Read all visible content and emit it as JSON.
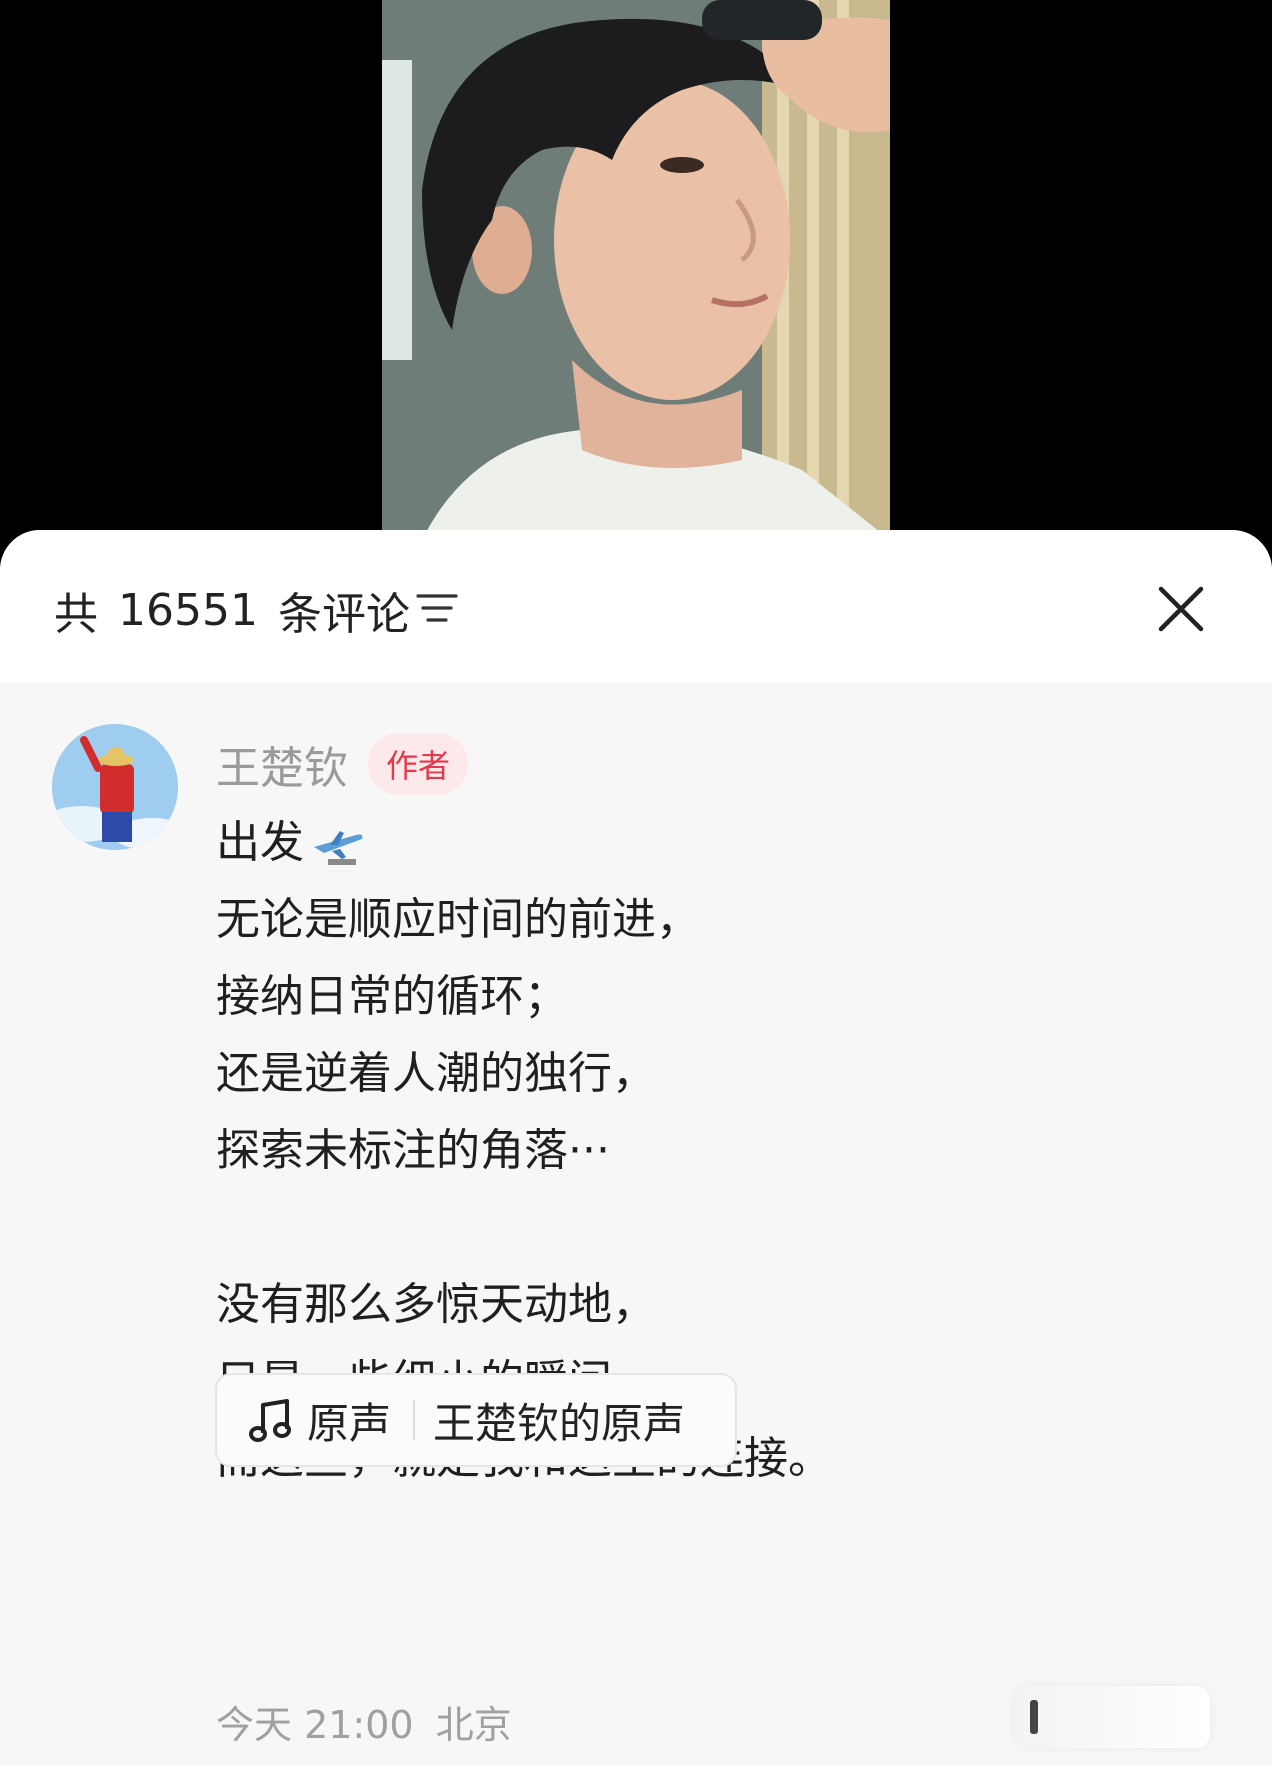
{
  "header": {
    "count_prefix": "共",
    "count": "16551",
    "count_suffix": "条评论",
    "sort_icon": "filter-lines-icon",
    "close_icon": "close-icon"
  },
  "comment": {
    "author": "王楚钦",
    "badge": "作者",
    "lines": [
      "出发",
      "无论是顺应时间的前进，",
      "接纳日常的循环；",
      "还是逆着人潮的独行，",
      "探索未标注的角落···",
      "",
      "没有那么多惊天动地，",
      "只是一些细小的瞬间，",
      "而这些，就是我和这里的连接。"
    ],
    "emoji_icon": "airplane-icon",
    "sound": {
      "icon": "music-note-icon",
      "label": "原声",
      "owner": "王楚钦的原声"
    },
    "time": "今天 21:00",
    "location": "北京"
  }
}
